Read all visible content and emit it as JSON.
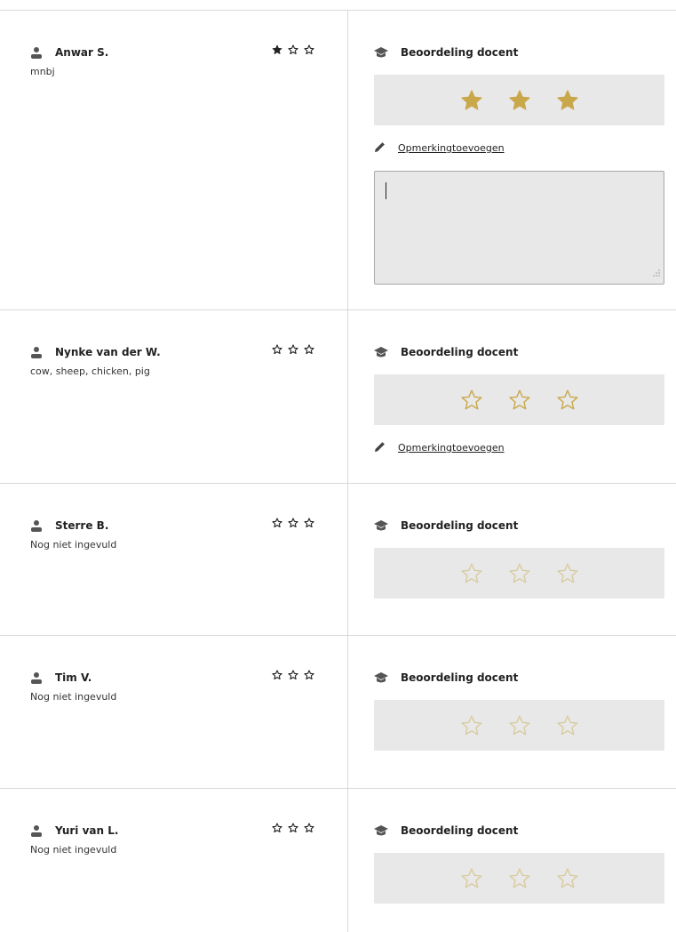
{
  "grade_heading": "Beoordeling docent",
  "add_comment_label": "Opmerkingtoevoegen",
  "colors": {
    "star_gold": "#c9a84c",
    "self_star": "#222222",
    "box_bg": "#e8e8e8"
  },
  "rows": [
    {
      "student": "Anwar S.",
      "answer": "mnbj",
      "self_rating": 1,
      "self_max": 3,
      "teacher_rating": 3,
      "teacher_max": 3,
      "rating_enabled": true,
      "comment_link": true,
      "comment_box": true,
      "comment_value": ""
    },
    {
      "student": "Nynke van der W.",
      "answer": "cow, sheep, chicken, pig",
      "self_rating": 0,
      "self_max": 3,
      "teacher_rating": 0,
      "teacher_max": 3,
      "rating_enabled": true,
      "comment_link": true,
      "comment_box": false
    },
    {
      "student": "Sterre B.",
      "answer": "Nog niet ingevuld",
      "self_rating": 0,
      "self_max": 3,
      "teacher_rating": 0,
      "teacher_max": 3,
      "rating_enabled": false,
      "comment_link": false,
      "comment_box": false
    },
    {
      "student": "Tim V.",
      "answer": "Nog niet ingevuld",
      "self_rating": 0,
      "self_max": 3,
      "teacher_rating": 0,
      "teacher_max": 3,
      "rating_enabled": false,
      "comment_link": false,
      "comment_box": false
    },
    {
      "student": "Yuri van L.",
      "answer": "Nog niet ingevuld",
      "self_rating": 0,
      "self_max": 3,
      "teacher_rating": 0,
      "teacher_max": 3,
      "rating_enabled": false,
      "comment_link": false,
      "comment_box": false
    }
  ]
}
